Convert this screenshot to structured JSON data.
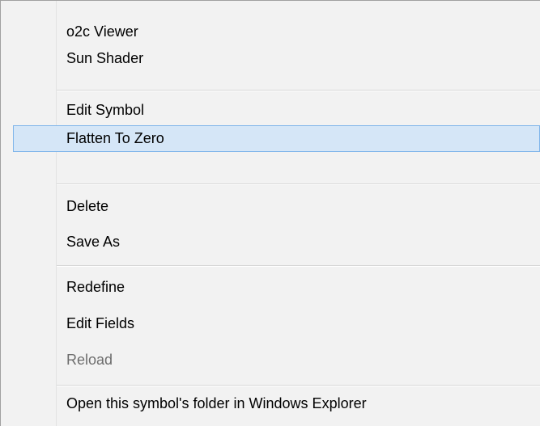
{
  "menu": {
    "items": [
      {
        "label": "o2c Viewer"
      },
      {
        "label": "Sun Shader"
      },
      {
        "label": "Edit Symbol"
      },
      {
        "label": "Flatten To Zero"
      },
      {
        "label": "Delete"
      },
      {
        "label": "Save As"
      },
      {
        "label": "Redefine"
      },
      {
        "label": "Edit Fields"
      },
      {
        "label": "Reload"
      },
      {
        "label": "Open this symbol's folder in Windows Explorer"
      }
    ],
    "highlighted_item": "Flatten To Zero",
    "disabled_items": [
      "Reload"
    ],
    "colors": {
      "background": "#f2f2f2",
      "highlight_fill": "#d5e6f7",
      "highlight_border": "#7eb4ea",
      "separator": "#d7d7d7",
      "disabled_text": "#6d6d6d"
    }
  }
}
